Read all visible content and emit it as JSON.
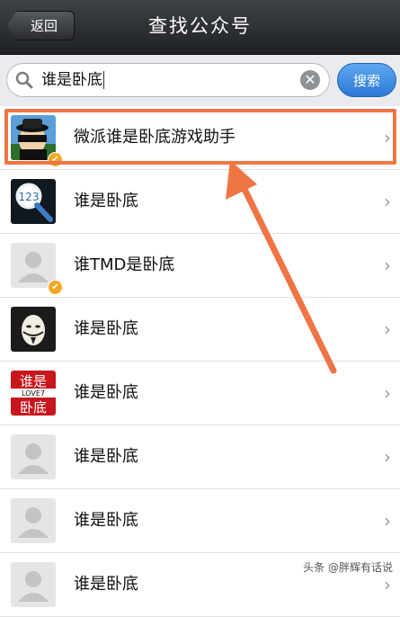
{
  "navbar": {
    "back_label": "返回",
    "title": "查找公众号"
  },
  "search": {
    "query": "谁是卧底",
    "button_label": "搜索"
  },
  "results": [
    {
      "name": "微派谁是卧底游戏助手",
      "verified": true,
      "avatar": "spy-avatar"
    },
    {
      "name": "谁是卧底",
      "verified": false,
      "avatar": "magnifier-123-avatar"
    },
    {
      "name": "谁TMD是卧底",
      "verified": true,
      "avatar": "default-avatar"
    },
    {
      "name": "谁是卧底",
      "verified": false,
      "avatar": "masked-face-avatar"
    },
    {
      "name": "谁是卧底",
      "verified": false,
      "avatar": "text-logo-avatar",
      "avatar_text": [
        "谁是",
        "LOVE7",
        "卧底"
      ]
    },
    {
      "name": "谁是卧底",
      "verified": false,
      "avatar": "default-avatar"
    },
    {
      "name": "谁是卧底",
      "verified": false,
      "avatar": "default-avatar"
    },
    {
      "name": "谁是卧底",
      "verified": false,
      "avatar": "default-avatar"
    }
  ],
  "annotation_color": "#ef7545",
  "watermark": "头条 @胖辉有话说"
}
